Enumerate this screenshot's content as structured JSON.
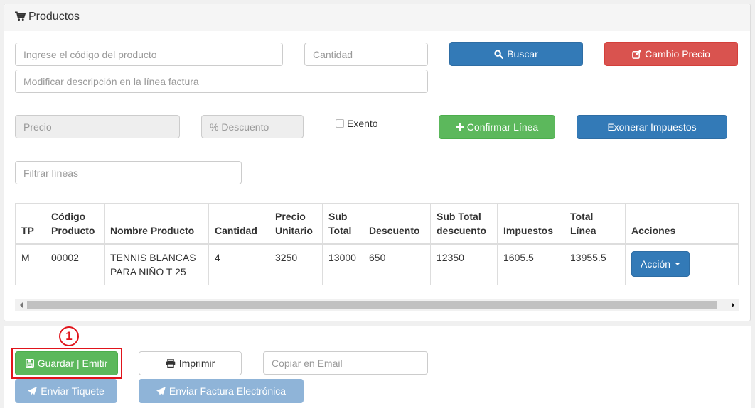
{
  "panel": {
    "title": "Productos",
    "title_icon": "shopping-cart-icon"
  },
  "form": {
    "codigo_placeholder": "Ingrese el código del producto",
    "cantidad_placeholder": "Cantidad",
    "descripcion_placeholder": "Modificar descripción en la línea factura",
    "precio_placeholder": "Precio",
    "descuento_placeholder": "% Descuento",
    "exento_label": "Exento",
    "filtrar_placeholder": "Filtrar líneas"
  },
  "buttons": {
    "buscar": "Buscar",
    "cambio_precio": "Cambio Precio",
    "confirmar_linea": "Confirmar Línea",
    "exonerar": "Exonerar Impuestos",
    "accion": "Acción",
    "guardar": "Guardar | Emitir",
    "imprimir": "Imprimir",
    "enviar_tiquete": "Enviar Tiquete",
    "enviar_factura": "Enviar Factura Electrónica"
  },
  "email_placeholder": "Copiar en Email",
  "table": {
    "headers": [
      "TP",
      "Código Producto",
      "Nombre Producto",
      "Cantidad",
      "Precio Unitario",
      "Sub Total",
      "Descuento",
      "Sub Total descuento",
      "Impuestos",
      "Total Línea",
      "Acciones"
    ],
    "rows": [
      {
        "tp": "M",
        "codigo": "00002",
        "nombre": "TENNIS BLANCAS PARA NIÑO T 25",
        "cantidad": "4",
        "precio_unitario": "3250",
        "sub_total": "13000",
        "descuento": "650",
        "sub_total_descuento": "12350",
        "impuestos": "1605.5",
        "total_linea": "13955.5"
      }
    ]
  },
  "annotation": {
    "badge": "1"
  },
  "colors": {
    "primary": "#337ab7",
    "danger": "#d9534f",
    "success": "#5cb85c",
    "annotation_red": "#e0141b"
  }
}
